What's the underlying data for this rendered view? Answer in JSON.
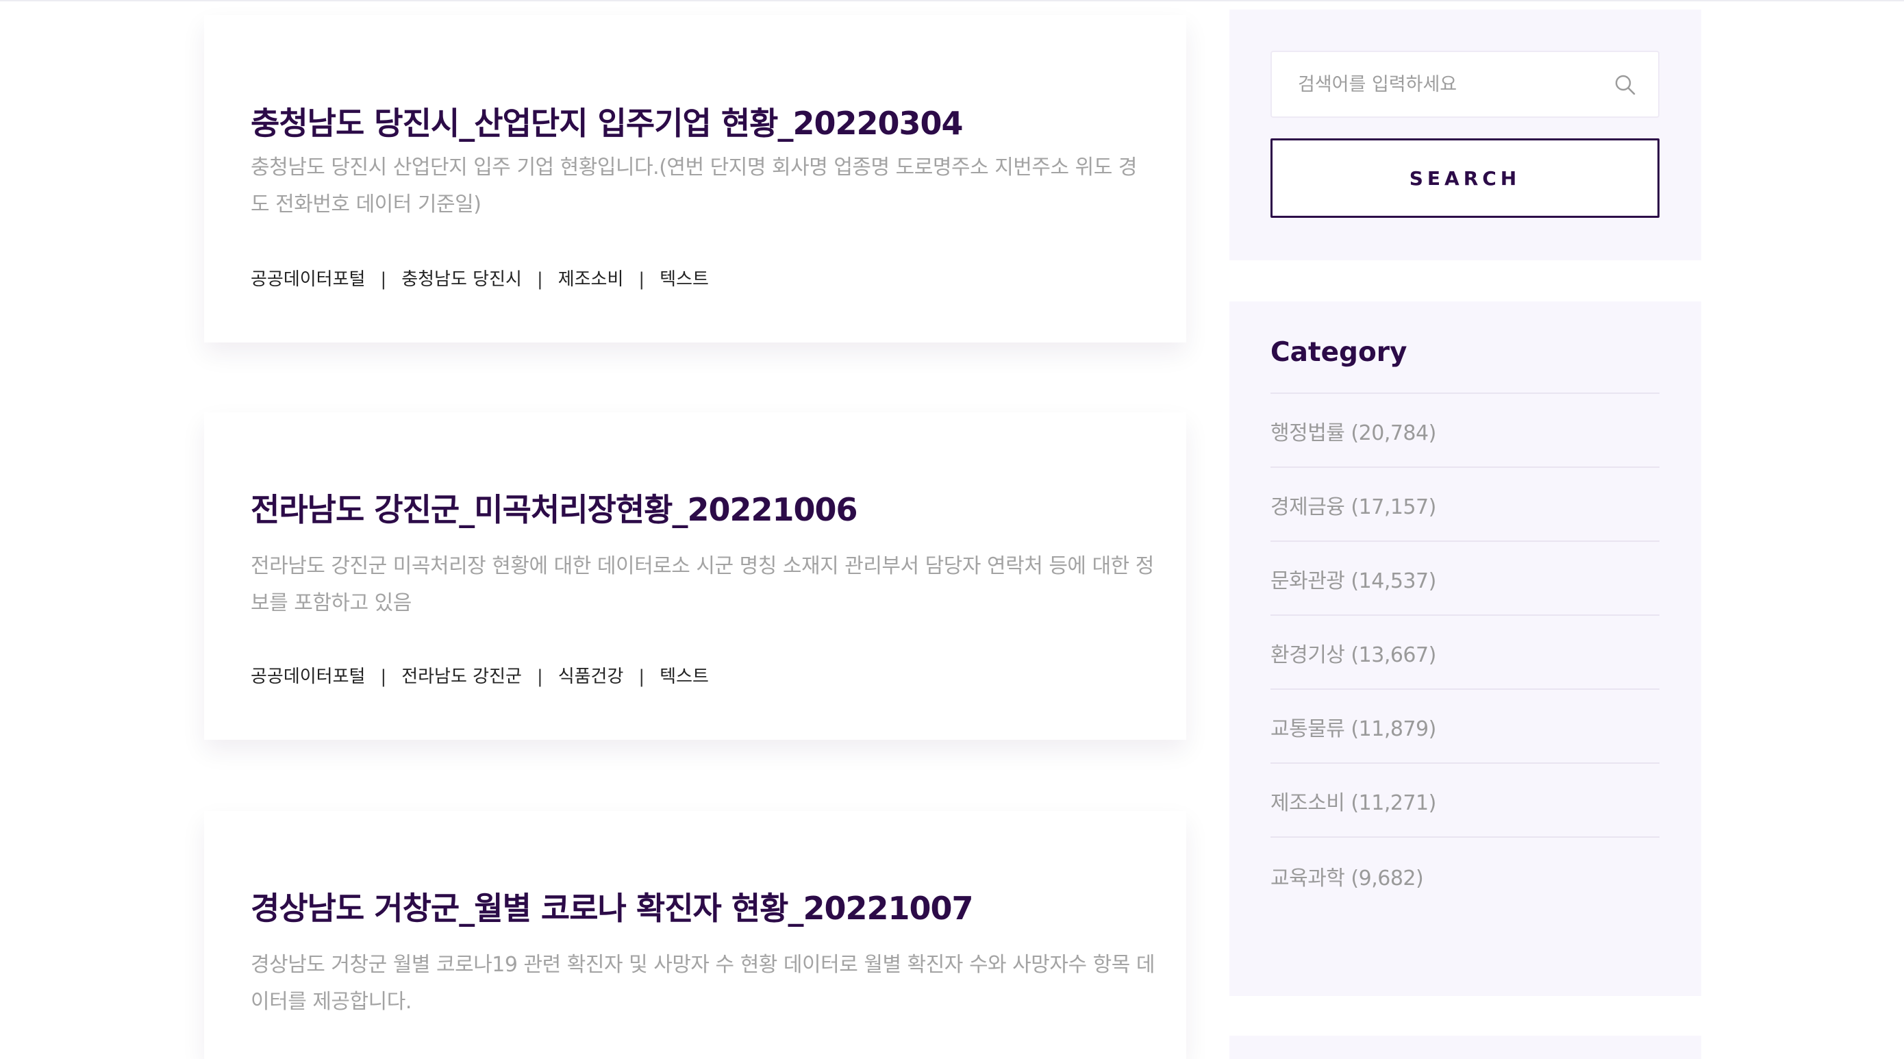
{
  "posts": [
    {
      "title": "충청남도 당진시_산업단지 입주기업 현황_20220304",
      "description": "충청남도 당진시 산업단지 입주 기업 현황입니다.(연번 단지명 회사명 업종명 도로명주소 지번주소 위도 경도 전화번호 데이터 기준일)",
      "tags": [
        "공공데이터포털",
        "충청남도 당진시",
        "제조소비",
        "텍스트"
      ]
    },
    {
      "title": "전라남도 강진군_미곡처리장현황_20221006",
      "description": "전라남도 강진군 미곡처리장 현황에 대한 데이터로소 시군 명칭 소재지 관리부서 담당자 연락처 등에 대한 정보를 포함하고 있음",
      "tags": [
        "공공데이터포털",
        "전라남도 강진군",
        "식품건강",
        "텍스트"
      ]
    },
    {
      "title": "경상남도 거창군_월별 코로나 확진자 현황_20221007",
      "description": "경상남도 거창군 월별 코로나19 관련 확진자 및 사망자 수 현황 데이터로 월별 확진자 수와 사망자수 항목 데이터를 제공합니다."
    }
  ],
  "tag_separator": "|",
  "search": {
    "placeholder": "검색어를 입력하세요",
    "button_label": "SEARCH",
    "icon": "search-icon"
  },
  "category": {
    "title": "Category",
    "items": [
      {
        "label": "행정법률 (20,784)"
      },
      {
        "label": "경제금융 (17,157)"
      },
      {
        "label": "문화관광 (14,537)"
      },
      {
        "label": "환경기상 (13,667)"
      },
      {
        "label": "교통물류 (11,879)"
      },
      {
        "label": "제조소비 (11,271)"
      },
      {
        "label": "교육과학 (9,682)"
      }
    ]
  },
  "colors": {
    "accent": "#2c0b48",
    "sidebar_bg": "#f8f6fd",
    "muted_text": "#a3a3a3"
  }
}
